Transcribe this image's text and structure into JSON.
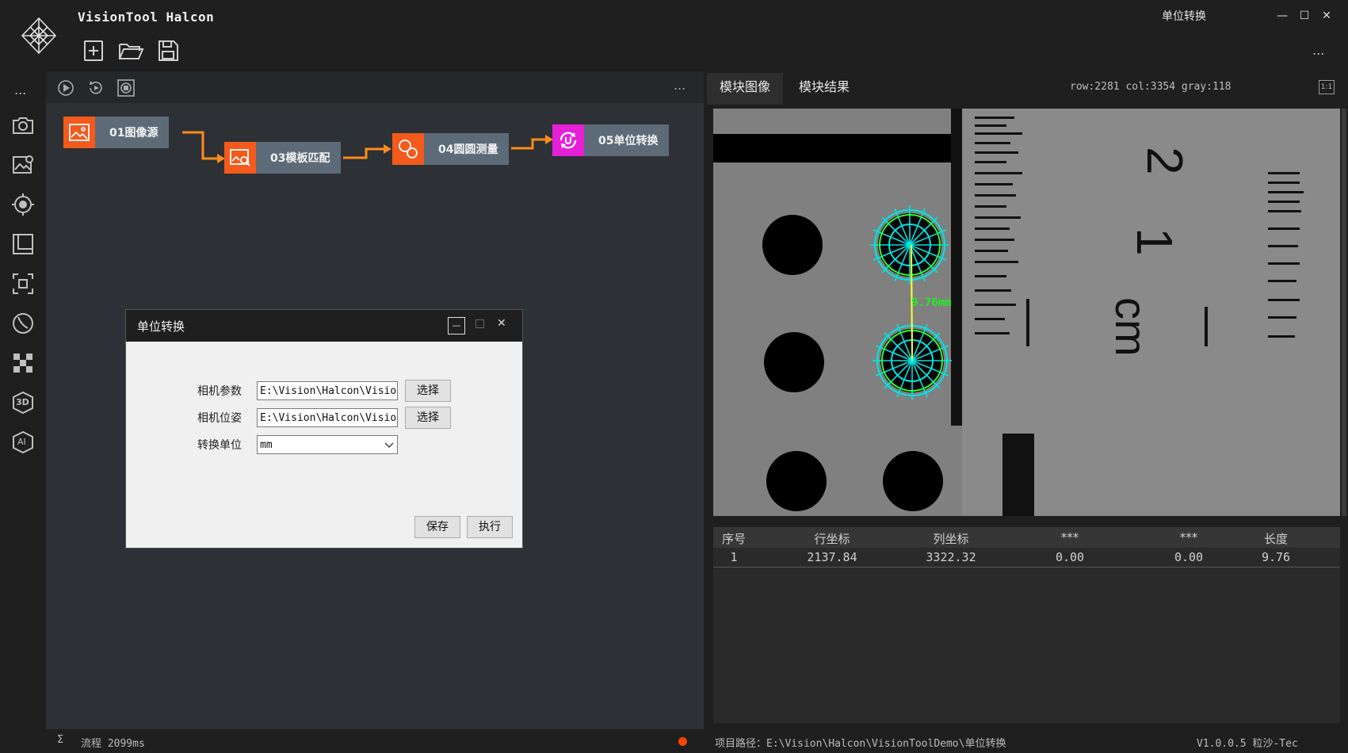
{
  "app": {
    "title": "VisionTool Halcon",
    "window_title": "单位转换"
  },
  "window_controls": {
    "minimize": "—",
    "maximize": "☐",
    "close": "✕"
  },
  "toolbar": {
    "more": "..."
  },
  "rail": {
    "more": "...",
    "icons": [
      "camera-icon",
      "image-settings-icon",
      "target-icon",
      "gallery-icon",
      "focus-icon",
      "measure-icon",
      "pattern-icon",
      "3d-icon",
      "ai-icon"
    ],
    "labels": {
      "three_d": "3D",
      "ai": "AI"
    }
  },
  "flow": {
    "more": "...",
    "nodes": [
      {
        "label": "01图像源",
        "color": "#f35a1c"
      },
      {
        "label": "03模板匹配",
        "color": "#f35a1c"
      },
      {
        "label": "04圆圆测量",
        "color": "#f35a1c"
      },
      {
        "label": "05单位转换",
        "color": "#e620d7"
      }
    ],
    "status": {
      "sigma": "Σ",
      "text": "流程 2099ms",
      "dot_color": "#ff4400"
    }
  },
  "dialog": {
    "title": "单位转换",
    "fields": [
      {
        "label": "相机参数",
        "value": "E:\\Vision\\Halcon\\Visio",
        "button": "选择"
      },
      {
        "label": "相机位姿",
        "value": "E:\\Vision\\Halcon\\Visio",
        "button": "选择"
      }
    ],
    "unit_label": "转换单位",
    "unit_value": "mm",
    "save": "保存",
    "run": "执行",
    "controls": {
      "minimize": "—",
      "maximize": "□",
      "close": "✕"
    }
  },
  "right": {
    "tabs": [
      "模块图像",
      "模块结果"
    ],
    "coord": "row:2281 col:3354 gray:118",
    "zoom": "1:1",
    "image": {
      "measurement": "9.76mm",
      "ruler_numbers": [
        "2",
        "1",
        "cm"
      ]
    },
    "table": {
      "columns": [
        "序号",
        "行坐标",
        "列坐标",
        "***",
        "***",
        "长度"
      ],
      "rows": [
        [
          "1",
          "2137.84",
          "3322.32",
          "0.00",
          "0.00",
          "9.76"
        ]
      ]
    },
    "status": {
      "path": "项目路径：E:\\Vision\\Halcon\\VisionToolDemo\\单位转换",
      "version": "V1.0.0.5 粒沙-Tec"
    }
  }
}
